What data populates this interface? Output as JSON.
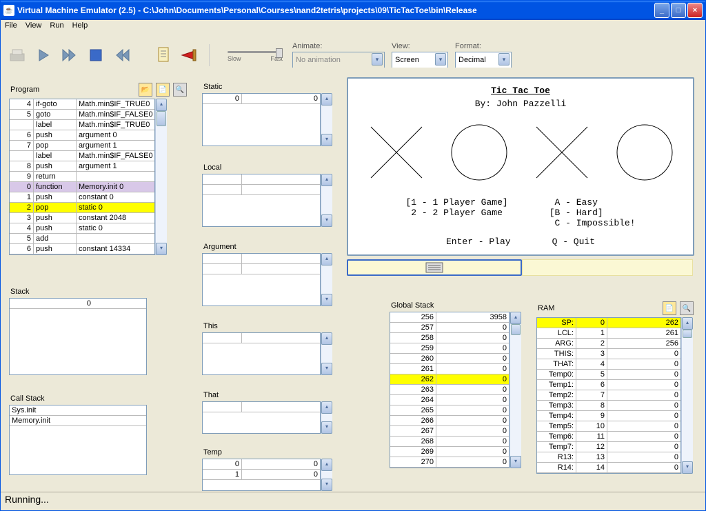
{
  "window": {
    "title": "Virtual Machine Emulator (2.5) - C:\\John\\Documents\\Personal\\Courses\\nand2tetris\\projects\\09\\TicTacToe\\bin\\Release"
  },
  "menu": {
    "file": "File",
    "view": "View",
    "run": "Run",
    "help": "Help"
  },
  "toolbar": {
    "slow": "Slow",
    "fast": "Fast",
    "animate_label": "Animate:",
    "animate_value": "No animation",
    "view_label": "View:",
    "view_value": "Screen",
    "format_label": "Format:",
    "format_value": "Decimal"
  },
  "panels": {
    "program": "Program",
    "stack": "Stack",
    "callstack": "Call Stack",
    "static": "Static",
    "local": "Local",
    "argument": "Argument",
    "this": "This",
    "that": "That",
    "temp": "Temp",
    "gstack": "Global Stack",
    "ram": "RAM"
  },
  "program": [
    {
      "n": "4",
      "op": "if-goto",
      "arg": "Math.min$IF_TRUE0"
    },
    {
      "n": "5",
      "op": "goto",
      "arg": "Math.min$IF_FALSE0"
    },
    {
      "n": "",
      "op": "label",
      "arg": "Math.min$IF_TRUE0"
    },
    {
      "n": "6",
      "op": "push",
      "arg": "argument 0"
    },
    {
      "n": "7",
      "op": "pop",
      "arg": "argument 1"
    },
    {
      "n": "",
      "op": "label",
      "arg": "Math.min$IF_FALSE0"
    },
    {
      "n": "8",
      "op": "push",
      "arg": "argument 1"
    },
    {
      "n": "9",
      "op": "return",
      "arg": ""
    },
    {
      "n": "0",
      "op": "function",
      "arg": "Memory.init 0",
      "hl": "purple"
    },
    {
      "n": "1",
      "op": "push",
      "arg": "constant 0"
    },
    {
      "n": "2",
      "op": "pop",
      "arg": "static 0",
      "hl": "yellow"
    },
    {
      "n": "3",
      "op": "push",
      "arg": "constant 2048"
    },
    {
      "n": "4",
      "op": "push",
      "arg": "static 0"
    },
    {
      "n": "5",
      "op": "add",
      "arg": ""
    },
    {
      "n": "6",
      "op": "push",
      "arg": "constant 14334"
    }
  ],
  "stack_top": "0",
  "callstack": [
    "Sys.init",
    "Memory.init"
  ],
  "static": [
    {
      "a": "0",
      "v": "0"
    }
  ],
  "temp": [
    {
      "a": "0",
      "v": "0"
    },
    {
      "a": "1",
      "v": "0"
    }
  ],
  "gstack": [
    {
      "a": "256",
      "v": "3958"
    },
    {
      "a": "257",
      "v": "0"
    },
    {
      "a": "258",
      "v": "0"
    },
    {
      "a": "259",
      "v": "0"
    },
    {
      "a": "260",
      "v": "0"
    },
    {
      "a": "261",
      "v": "0"
    },
    {
      "a": "262",
      "v": "0",
      "hl": "yellow"
    },
    {
      "a": "263",
      "v": "0"
    },
    {
      "a": "264",
      "v": "0"
    },
    {
      "a": "265",
      "v": "0"
    },
    {
      "a": "266",
      "v": "0"
    },
    {
      "a": "267",
      "v": "0"
    },
    {
      "a": "268",
      "v": "0"
    },
    {
      "a": "269",
      "v": "0"
    },
    {
      "a": "270",
      "v": "0"
    }
  ],
  "ram": [
    {
      "l": "SP:",
      "a": "0",
      "v": "262",
      "hl": "yellow"
    },
    {
      "l": "LCL:",
      "a": "1",
      "v": "261"
    },
    {
      "l": "ARG:",
      "a": "2",
      "v": "256"
    },
    {
      "l": "THIS:",
      "a": "3",
      "v": "0"
    },
    {
      "l": "THAT:",
      "a": "4",
      "v": "0"
    },
    {
      "l": "Temp0:",
      "a": "5",
      "v": "0"
    },
    {
      "l": "Temp1:",
      "a": "6",
      "v": "0"
    },
    {
      "l": "Temp2:",
      "a": "7",
      "v": "0"
    },
    {
      "l": "Temp3:",
      "a": "8",
      "v": "0"
    },
    {
      "l": "Temp4:",
      "a": "9",
      "v": "0"
    },
    {
      "l": "Temp5:",
      "a": "10",
      "v": "0"
    },
    {
      "l": "Temp6:",
      "a": "11",
      "v": "0"
    },
    {
      "l": "Temp7:",
      "a": "12",
      "v": "0"
    },
    {
      "l": "R13:",
      "a": "13",
      "v": "0"
    },
    {
      "l": "R14:",
      "a": "14",
      "v": "0"
    }
  ],
  "screen": {
    "title": "Tic Tac Toe",
    "author": "By: John Pazzelli",
    "opt1a": "[1 - 1 Player Game]",
    "opt1b": " 2 - 2 Player Game",
    "opt2a": " A - Easy",
    "opt2b": "[B - Hard]",
    "opt2c": " C - Impossible!",
    "play": "Enter - Play",
    "quit": "Q - Quit"
  },
  "status": "Running..."
}
